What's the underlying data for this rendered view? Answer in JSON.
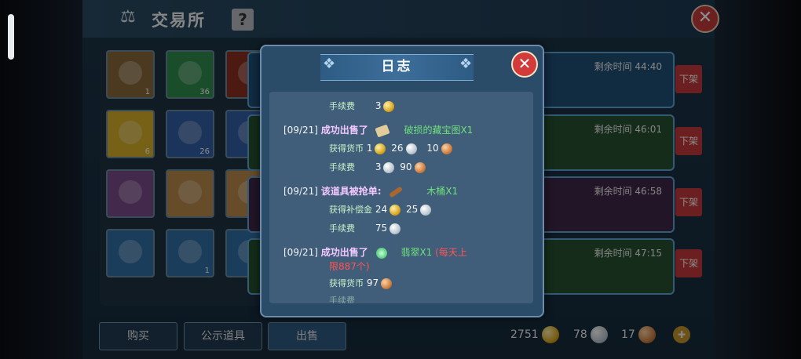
{
  "window": {
    "title": "交易所",
    "help_label": "?",
    "close_label": "✕"
  },
  "grid_items": [
    {
      "count": "1",
      "color": "#8a6a3a",
      "icon": "log-icon"
    },
    {
      "count": "36",
      "color": "#2f8c4a",
      "icon": "jade-orb-icon"
    },
    {
      "count": "",
      "color": "#8a2f1f",
      "icon": "red-egg-icon"
    },
    {
      "count": "6",
      "color": "#d9b02a",
      "icon": "gold-gem-icon"
    },
    {
      "count": "26",
      "color": "#2f5fa6",
      "icon": "fish-bag-icon"
    },
    {
      "count": "",
      "color": "#2f5fa6",
      "icon": "blue-bag-icon"
    },
    {
      "count": "",
      "color": "#7a4a88",
      "icon": "dark-statue-icon"
    },
    {
      "count": "",
      "color": "#b98a4a",
      "icon": "white-statue-icon"
    },
    {
      "count": "",
      "color": "#b98a4a",
      "icon": "white-statue-icon"
    },
    {
      "count": "",
      "color": "#2f6ea6",
      "icon": "beetle-icon"
    },
    {
      "count": "1",
      "color": "#2f6ea6",
      "icon": "beetle-icon"
    },
    {
      "count": "",
      "color": "#2f6ea6",
      "icon": "beetle-icon"
    }
  ],
  "rows": [
    {
      "time_label": "剩余时间",
      "time": "44:40",
      "off_label": "下架"
    },
    {
      "time_label": "剩余时间",
      "time": "46:01",
      "off_label": "下架"
    },
    {
      "time_label": "剩余时间",
      "time": "46:58",
      "off_label": "下架"
    },
    {
      "time_label": "剩余时间",
      "time": "47:15",
      "off_label": "下架"
    }
  ],
  "tabs": {
    "buy": "购买",
    "public": "公示道具",
    "sell": "出售"
  },
  "currency": {
    "gold": "2751",
    "silver": "78",
    "copper": "17"
  },
  "dialog": {
    "title": "日志",
    "close_label": "✕",
    "log": {
      "fee_label": "手续费",
      "fee1": "3",
      "entry1_date": "[09/21]",
      "entry1_action": "成功出售了",
      "entry1_item": "破损的藏宝图X1",
      "gain_label": "获得货币",
      "entry1_gold": "1",
      "entry1_silver": "26",
      "entry1_copper": "10",
      "entry1_fee_silver": "3",
      "entry1_fee_copper": "90",
      "entry2_date": "[09/21]",
      "entry2_action": "该道具被抢单:",
      "entry2_item": "木桶X1",
      "comp_label": "获得补偿金",
      "entry2_comp_gold": "24",
      "entry2_comp_silver": "25",
      "entry2_fee_silver": "75",
      "entry3_date": "[09/21]",
      "entry3_action": "成功出售了",
      "entry3_item": "翡翠X1",
      "entry3_warn": "(每天上",
      "entry3_warn2": "限887个)",
      "entry3_copper": "97"
    }
  }
}
